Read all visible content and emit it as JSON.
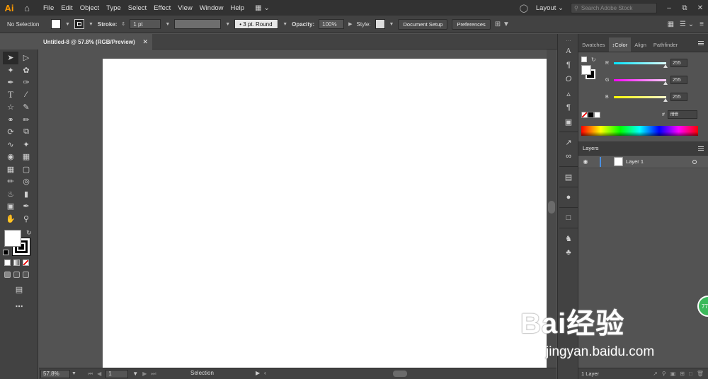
{
  "app": {
    "logo": "Ai"
  },
  "menubar": {
    "items": [
      "File",
      "Edit",
      "Object",
      "Type",
      "Select",
      "Effect",
      "View",
      "Window",
      "Help"
    ],
    "layout_label": "Layout",
    "search_placeholder": "Search Adobe Stock"
  },
  "control": {
    "selection_label": "No Selection",
    "stroke_label": "Stroke:",
    "stroke_weight": "1 pt",
    "brush_label": "3 pt. Round",
    "opacity_label": "Opacity:",
    "opacity_value": "100%",
    "style_label": "Style:",
    "doc_setup": "Document Setup",
    "preferences": "Preferences"
  },
  "document": {
    "tab_title": "Untitled-8 @ 57.8% (RGB/Preview)"
  },
  "status": {
    "zoom": "57.8%",
    "page": "1",
    "tool": "Selection"
  },
  "color_panel": {
    "tabs": [
      "Swatches",
      "Color",
      "Align",
      "Pathfinder"
    ],
    "active_tab": "Color",
    "channels": [
      {
        "name": "R",
        "value": "255",
        "color": "#00e5ff"
      },
      {
        "name": "G",
        "value": "255",
        "color": "#ff00ff"
      },
      {
        "name": "B",
        "value": "255",
        "color": "#ffff00"
      }
    ],
    "hex_value": "ffffff"
  },
  "layers_panel": {
    "title": "Layers",
    "layers": [
      {
        "name": "Layer 1"
      }
    ],
    "footer_count": "1 Layer"
  },
  "overlay": {
    "badge": "77",
    "watermark_main": "Bai经验",
    "watermark_sub": "jingyan.baidu.com"
  }
}
